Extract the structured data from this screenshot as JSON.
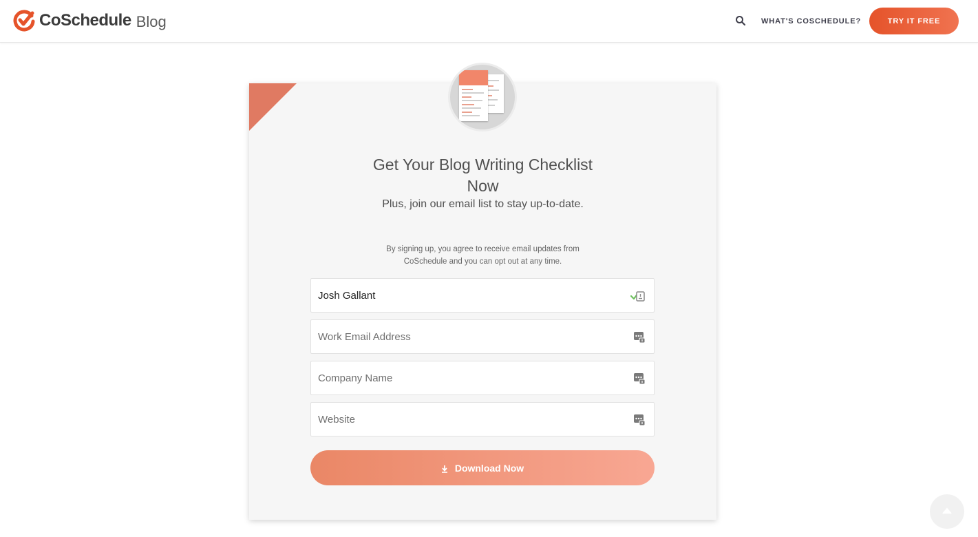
{
  "header": {
    "logo_brand": "CoSchedule",
    "logo_sub": "Blog",
    "search_icon": "search-icon",
    "nav_whats": "WHAT'S COSCHEDULE?",
    "cta_label": "TRY IT FREE",
    "accent": "#e5532a"
  },
  "card": {
    "title_line1": "Get Your Blog Writing Checklist",
    "title_line2": "Now",
    "subtitle": "Plus, join our email list to stay up-to-date.",
    "legal_line1": "By signing up, you agree to receive email updates from",
    "legal_line2": "CoSchedule and you can opt out at any time.",
    "corner_color": "#e07a62",
    "fields": [
      {
        "value": "Josh Gallant",
        "placeholder": "",
        "icon": "autofill-check-icon"
      },
      {
        "value": "",
        "placeholder": "Work Email Address",
        "icon": "autofill-key-icon"
      },
      {
        "value": "",
        "placeholder": "Company Name",
        "icon": "autofill-key-icon"
      },
      {
        "value": "",
        "placeholder": "Website",
        "icon": "autofill-key-icon"
      }
    ],
    "download_label": "Download Now",
    "download_icon": "download-icon"
  },
  "scroll_top_icon": "chevron-up-icon"
}
